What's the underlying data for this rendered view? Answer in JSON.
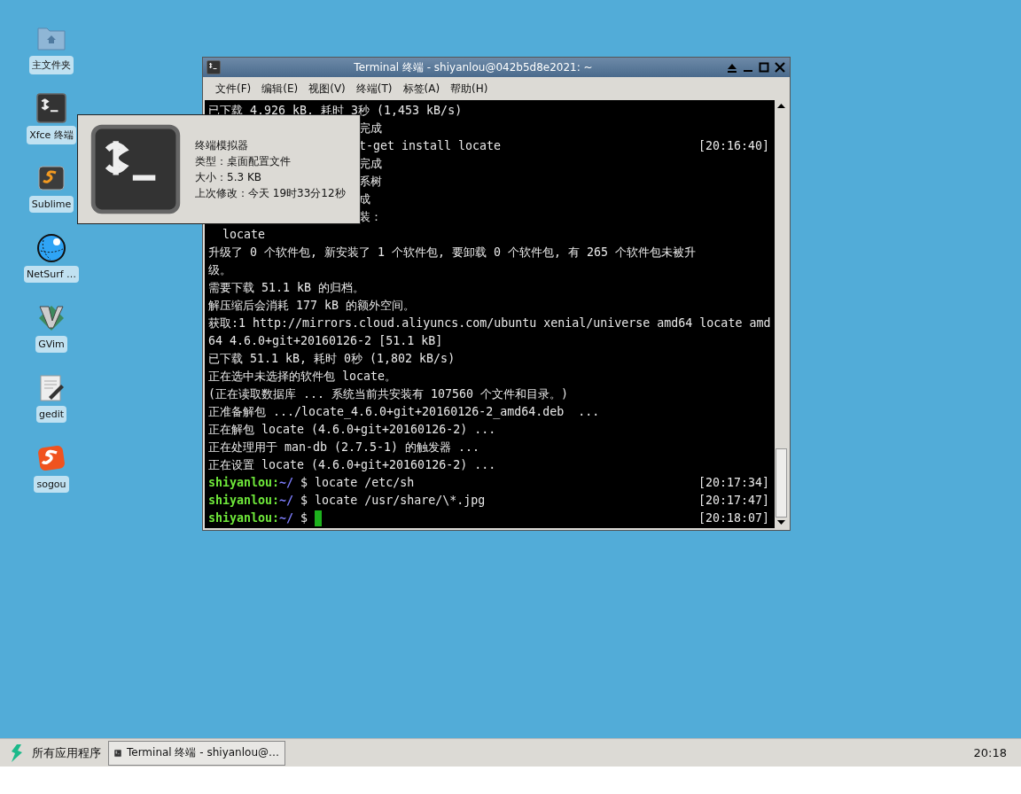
{
  "desktop_icons": [
    {
      "kind": "folder",
      "label": "主文件夹"
    },
    {
      "kind": "terminal",
      "label": "Xfce 终端"
    },
    {
      "kind": "sublime",
      "label": "Sublime"
    },
    {
      "kind": "globe",
      "label": "NetSurf …"
    },
    {
      "kind": "vim",
      "label": "GVim"
    },
    {
      "kind": "editor",
      "label": "gedit"
    },
    {
      "kind": "sogou",
      "label": "sogou"
    }
  ],
  "window": {
    "title": "Terminal 终端 - shiyanlou@042b5d8e2021: ~",
    "menu": [
      "文件(F)",
      "编辑(E)",
      "视图(V)",
      "终端(T)",
      "标签(A)",
      "帮助(H)"
    ],
    "lines": [
      {
        "kind": "output",
        "text": "已下载 4,926 kB, 耗时 3秒 (1,453 kB/s)"
      },
      {
        "kind": "partial",
        "text": "完成"
      },
      {
        "kind": "partial",
        "text": "t-get install locate",
        "time": "[20:16:40]"
      },
      {
        "kind": "partial",
        "text": "完成"
      },
      {
        "kind": "partial",
        "text": "系树"
      },
      {
        "kind": "partial",
        "text": "成"
      },
      {
        "kind": "partial",
        "text": "装："
      },
      {
        "kind": "output",
        "text": "  locate"
      },
      {
        "kind": "output",
        "text": "升级了 0 个软件包, 新安装了 1 个软件包, 要卸载 0 个软件包, 有 265 个软件包未被升"
      },
      {
        "kind": "output",
        "text": "级。"
      },
      {
        "kind": "output",
        "text": "需要下载 51.1 kB 的归档。"
      },
      {
        "kind": "output",
        "text": "解压缩后会消耗 177 kB 的额外空间。"
      },
      {
        "kind": "output",
        "text": "获取:1 http://mirrors.cloud.aliyuncs.com/ubuntu xenial/universe amd64 locate amd"
      },
      {
        "kind": "output",
        "text": "64 4.6.0+git+20160126-2 [51.1 kB]"
      },
      {
        "kind": "output",
        "text": "已下载 51.1 kB, 耗时 0秒 (1,802 kB/s)"
      },
      {
        "kind": "output",
        "text": "正在选中未选择的软件包 locate。"
      },
      {
        "kind": "output",
        "text": "(正在读取数据库 ... 系统当前共安装有 107560 个文件和目录。)"
      },
      {
        "kind": "output",
        "text": "正准备解包 .../locate_4.6.0+git+20160126-2_amd64.deb  ..."
      },
      {
        "kind": "output",
        "text": "正在解包 locate (4.6.0+git+20160126-2) ..."
      },
      {
        "kind": "output",
        "text": "正在处理用于 man-db (2.7.5-1) 的触发器 ..."
      },
      {
        "kind": "output",
        "text": "正在设置 locate (4.6.0+git+20160126-2) ..."
      },
      {
        "kind": "prompt",
        "user": "shiyanlou:",
        "path": "~/",
        "sign": "$",
        "text": "locate /etc/sh",
        "time": "[20:17:34]"
      },
      {
        "kind": "prompt",
        "user": "shiyanlou:",
        "path": "~/",
        "sign": "$",
        "text": "locate /usr/share/\\*.jpg",
        "time": "[20:17:47]"
      },
      {
        "kind": "prompt",
        "user": "shiyanlou:",
        "path": "~/",
        "sign": "$",
        "cursor": true,
        "time": "[20:18:07]"
      }
    ]
  },
  "tooltip": {
    "title": "终端模拟器",
    "lines": [
      "类型：桌面配置文件",
      "大小：5.3 KB",
      "上次修改：今天 19时33分12秒"
    ]
  },
  "taskbar": {
    "menu_label": "所有应用程序",
    "tasks": [
      {
        "label": "Terminal 终端 - shiyanlou@…",
        "selected": true
      }
    ],
    "clock": "20:18"
  }
}
